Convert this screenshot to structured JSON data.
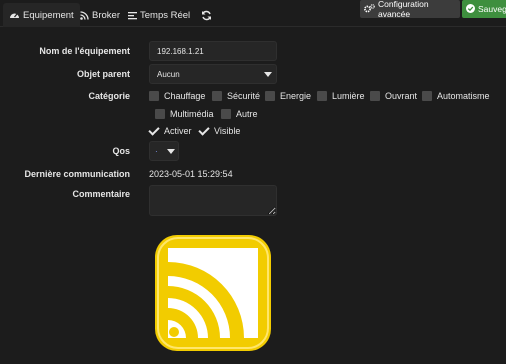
{
  "tabs": [
    {
      "label": "Equipement",
      "icon": "tachometer-icon"
    },
    {
      "label": "Broker",
      "icon": "rss-icon"
    },
    {
      "label": "Temps Réel",
      "icon": "list-icon"
    },
    {
      "label": "",
      "icon": "refresh-icon"
    }
  ],
  "actions": {
    "advanced_label": "Configuration avancée",
    "save_label": "Sauvega"
  },
  "form": {
    "name_label": "Nom de l'équipement",
    "name_value": "192.168.1.21",
    "parent_label": "Objet parent",
    "parent_value": "Aucun",
    "category_label": "Catégorie",
    "categories": [
      "Chauffage",
      "Sécurité",
      "Energie",
      "Lumière",
      "Ouvrant",
      "Automatisme",
      "Multimédia",
      "Autre"
    ],
    "activer_label": "Activer",
    "visible_label": "Visible",
    "qos_label": "Qos",
    "qos_value": "·",
    "last_comm_label": "Dernière communication",
    "last_comm_value": "2023-05-01 15:29:54",
    "comment_label": "Commentaire"
  },
  "colors": {
    "background": "#1c1c1c",
    "panel": "#262626",
    "save_green": "#3e8f3e",
    "advanced_gray": "#3c3c3c",
    "logo_yellow": "#f2cc00"
  }
}
